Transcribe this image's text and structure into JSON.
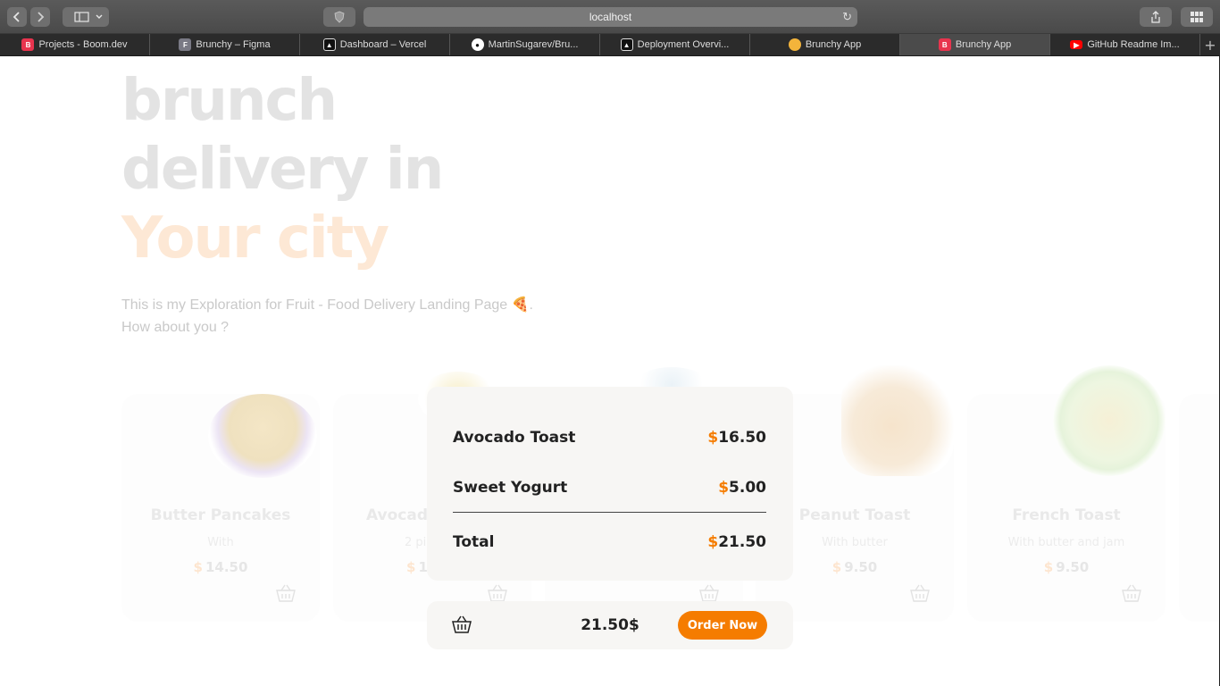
{
  "browser": {
    "url": "localhost",
    "tabs": [
      {
        "title": "Projects - Boom.dev",
        "icon": "boom-icon",
        "color": "#e8344e"
      },
      {
        "title": "Brunchy – Figma",
        "icon": "figma-icon",
        "color": "#7a7a85"
      },
      {
        "title": "Dashboard – Vercel",
        "icon": "vercel-icon",
        "color": "#111111"
      },
      {
        "title": "MartinSugarev/Bru...",
        "icon": "github-icon",
        "color": "#111111"
      },
      {
        "title": "Deployment Overvi...",
        "icon": "vercel-icon",
        "color": "#111111"
      },
      {
        "title": "Brunchy App",
        "icon": "pancake-icon",
        "color": "#f3b43b"
      },
      {
        "title": "Brunchy App",
        "icon": "boom-icon",
        "color": "#e8344e"
      },
      {
        "title": "GitHub Readme Im...",
        "icon": "youtube-icon",
        "color": "#ff0000"
      }
    ],
    "active_tab": 6
  },
  "hero": {
    "line1": "brunch",
    "line2": "delivery in",
    "line3": "Your city",
    "description_line1": "This is my Exploration for Fruit - Food Delivery Landing Page 🍕.",
    "description_line2": "How about you ?"
  },
  "products": [
    {
      "name": "Butter Pancakes",
      "desc": "With",
      "currency": "$",
      "price": "14.50"
    },
    {
      "name": "Avocad",
      "desc": "2 pi",
      "currency": "$",
      "price": "1("
    },
    {
      "name": "",
      "desc": "",
      "currency": "",
      "price": ""
    },
    {
      "name": "Peanut Toast",
      "desc": "With butter",
      "currency": "$",
      "price": "9.50"
    },
    {
      "name": "French Toast",
      "desc": "With butter and jam",
      "currency": "$",
      "price": "9.50"
    }
  ],
  "cart": {
    "items": [
      {
        "name": "Avocado Toast",
        "currency": "$",
        "amount": "16.50"
      },
      {
        "name": "Sweet Yogurt",
        "currency": "$",
        "amount": "5.00"
      }
    ],
    "total_label": "Total",
    "total_currency": "$",
    "total_amount": "21.50",
    "footer_total": "21.50$",
    "order_label": "Order Now"
  },
  "colors": {
    "accent": "#f57c00"
  }
}
